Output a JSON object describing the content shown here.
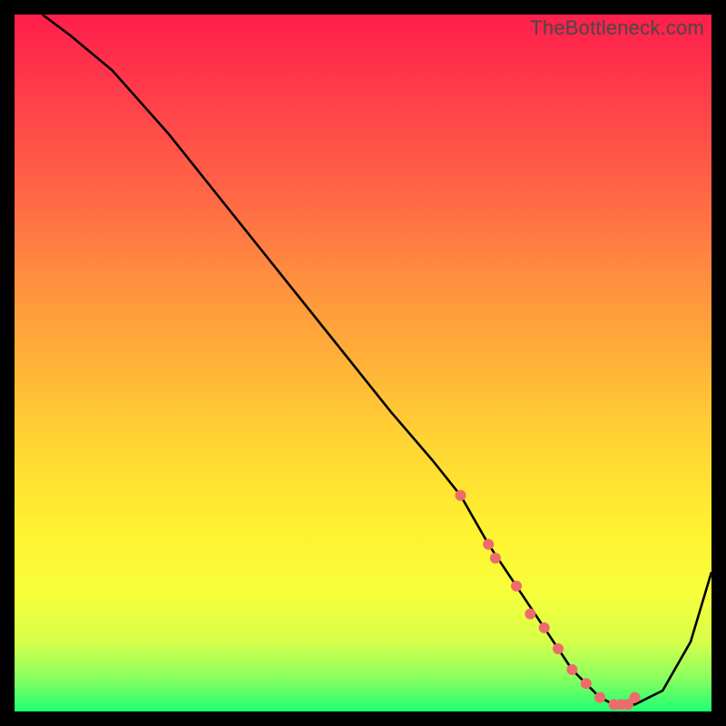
{
  "watermark": "TheBottleneck.com",
  "chart_data": {
    "type": "line",
    "title": "",
    "xlabel": "",
    "ylabel": "",
    "xlim": [
      0,
      100
    ],
    "ylim": [
      0,
      100
    ],
    "series": [
      {
        "name": "bottleneck-curve",
        "x": [
          4,
          8,
          14,
          22,
          30,
          38,
          46,
          54,
          60,
          64,
          68,
          72,
          76,
          80,
          84,
          86,
          89,
          93,
          97,
          100
        ],
        "values": [
          100,
          97,
          92,
          83,
          73,
          63,
          53,
          43,
          36,
          31,
          24,
          18,
          12,
          6,
          2,
          1,
          1,
          3,
          10,
          20
        ]
      }
    ],
    "markers": {
      "name": "highlight-dots",
      "x": [
        64,
        68,
        69,
        72,
        74,
        76,
        78,
        80,
        82,
        84,
        86,
        87,
        88,
        89
      ],
      "values": [
        31,
        24,
        22,
        18,
        14,
        12,
        9,
        6,
        4,
        2,
        1,
        1,
        1,
        2
      ]
    }
  }
}
